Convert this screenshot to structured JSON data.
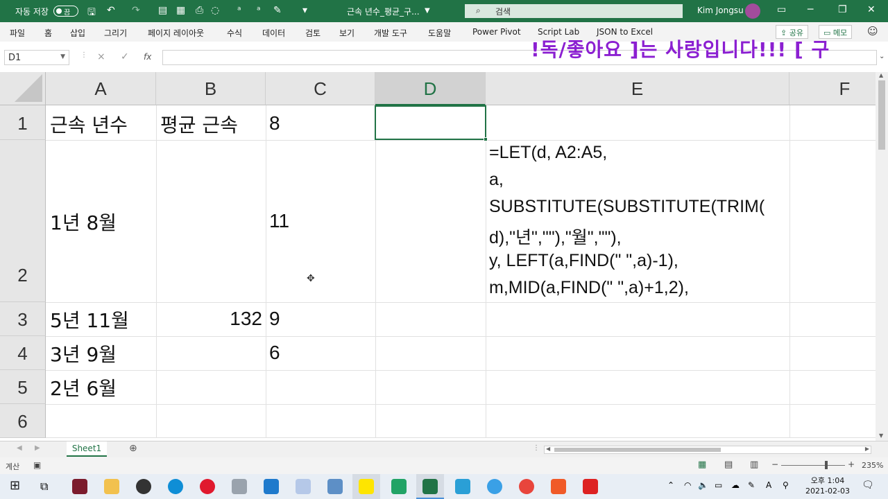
{
  "titlebar": {
    "autosave_label": "자동 저장",
    "autosave_state": "끔",
    "doc_title": "근속 년수_평균_구...",
    "search_placeholder": "검색",
    "user_name": "Kim Jongsu"
  },
  "ribbon": {
    "tabs": [
      "파일",
      "홈",
      "삽입",
      "그리기",
      "페이지 레이아웃",
      "수식",
      "데이터",
      "검토",
      "보기",
      "개발 도구",
      "도움말",
      "Power Pivot",
      "Script Lab",
      "JSON to Excel"
    ],
    "share_label": "공유",
    "memo_label": "메모"
  },
  "formula_bar": {
    "name_box": "D1",
    "cancel_icon": "×",
    "enter_icon": "✓",
    "fx_icon": "fx",
    "formula": ""
  },
  "overlay_text": "!독/좋아요 ]는 사랑입니다!!!   [   구",
  "grid": {
    "columns": [
      "A",
      "B",
      "C",
      "D",
      "E",
      "F"
    ],
    "selected_column": "D",
    "rows": [
      "1",
      "2",
      "3",
      "4",
      "5",
      "6"
    ],
    "cells": {
      "A1": "근속 년수",
      "B1": "평균 근속",
      "C1": "8",
      "A2": "1년 8월",
      "C2": "11",
      "E2": [
        "=LET(d, A2:A5,",
        "a,",
        "SUBSTITUTE(SUBSTITUTE(TRIM(",
        "d),\"년\",\"\"),\"월\",\"\"),",
        "y, LEFT(a,FIND(\" \",a)-1),",
        "m,MID(a,FIND(\" \",a)+1,2),"
      ],
      "A3": "5년 11월",
      "B3": "132",
      "C3": "9",
      "A4": "3년 9월",
      "C4": "6",
      "A5": "2년 6월"
    }
  },
  "sheet_tabs": [
    "Sheet1"
  ],
  "statusbar": {
    "mode": "계산",
    "zoom": "235%"
  },
  "taskbar": {
    "time": "오후 1:04",
    "date": "2021-02-03"
  },
  "colors": {
    "excel_green": "#217346",
    "overlay_purple": "#8b1fd1"
  }
}
